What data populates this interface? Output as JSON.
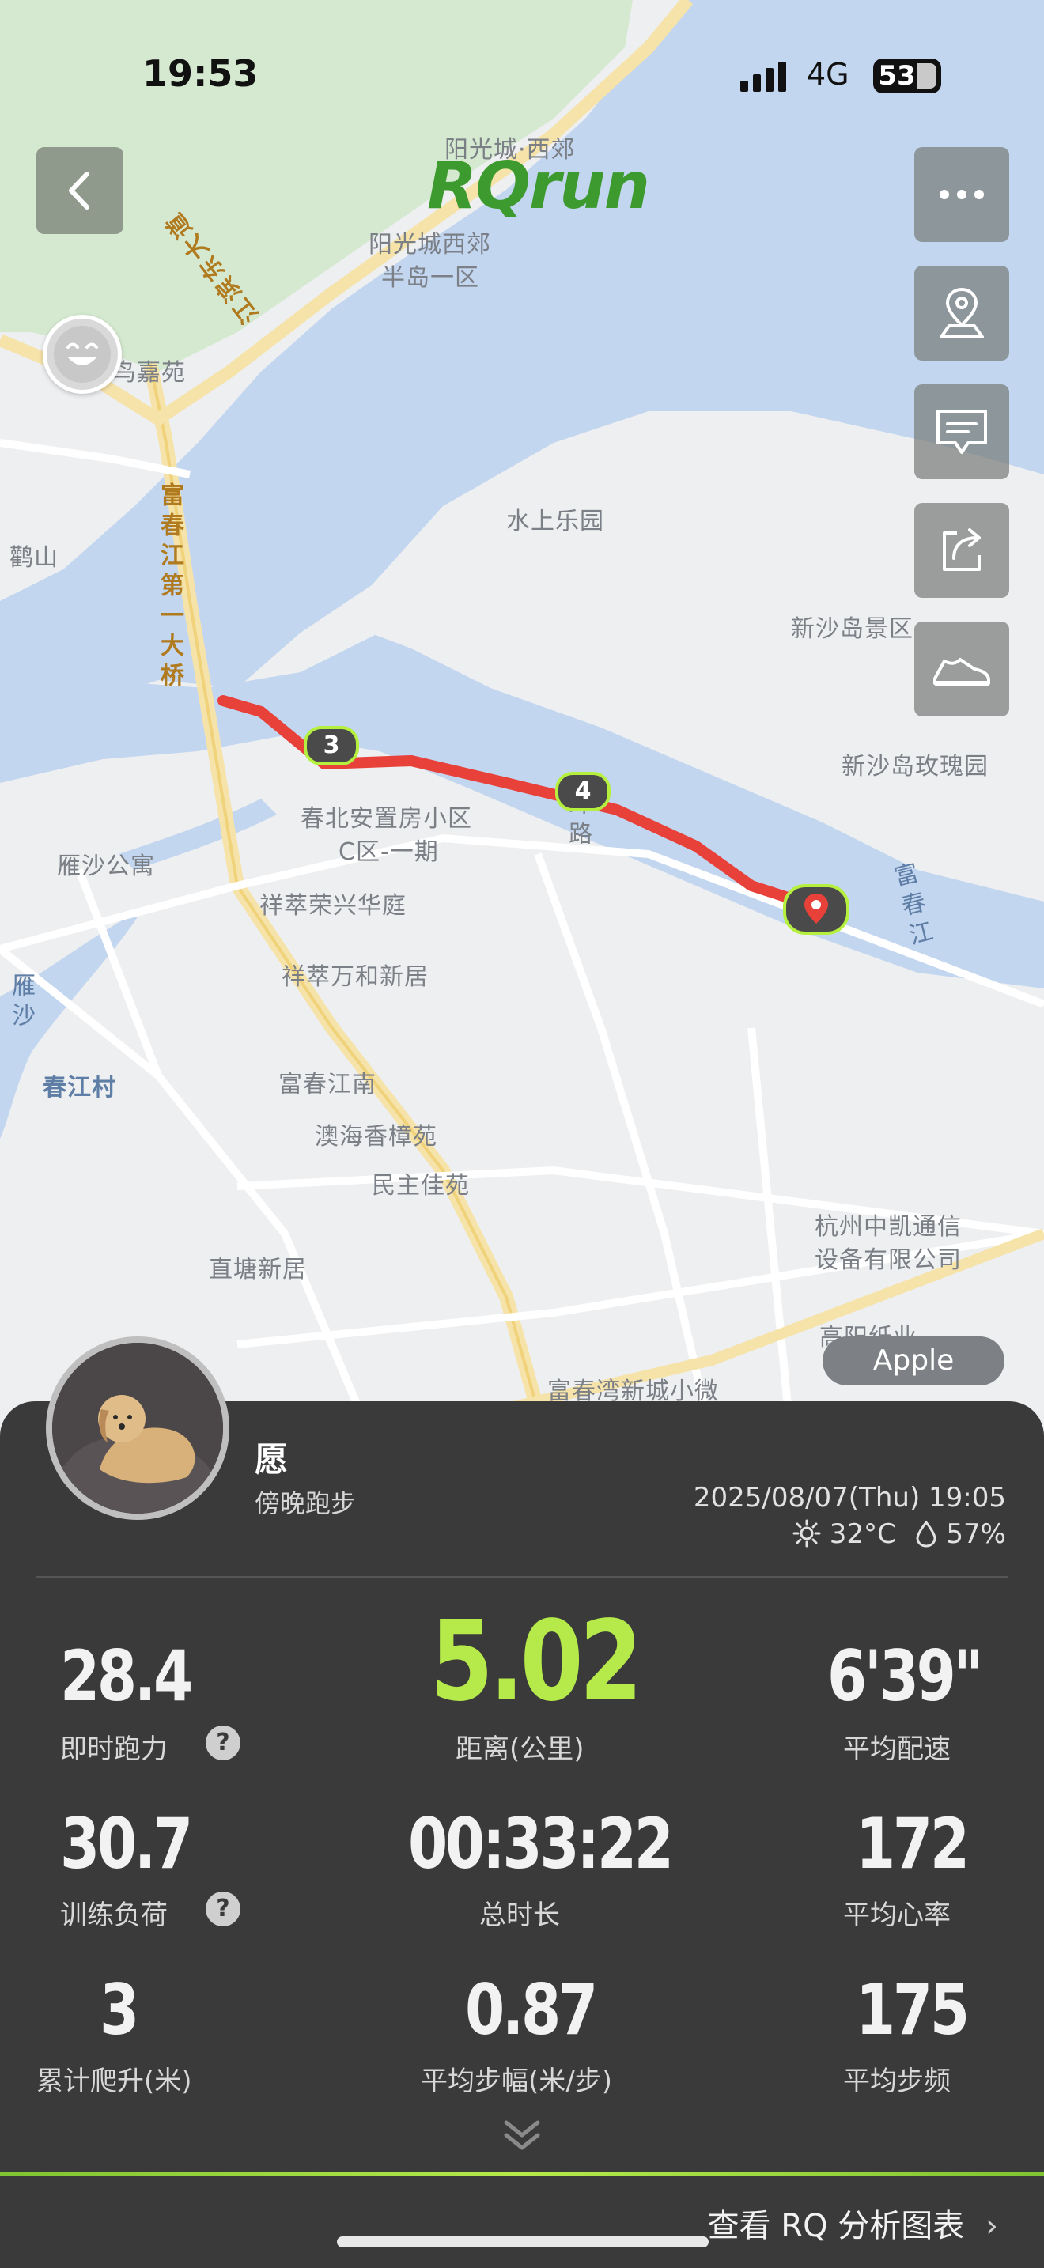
{
  "status_bar": {
    "time": "19:53",
    "network": "4G",
    "battery": "53"
  },
  "map": {
    "logo": "RQrun",
    "place_labels": [
      {
        "id": "yangguang-xijiao",
        "text": "阳光城·西郊"
      },
      {
        "id": "yangguang-xijiao-2",
        "text": "阳光城西郊"
      },
      {
        "id": "bandao-yiqu",
        "text": "半岛一区"
      },
      {
        "id": "niao-jia-yuan",
        "text": "鸟嘉苑"
      },
      {
        "id": "he-shan",
        "text": "鹳山"
      },
      {
        "id": "shuishang-leyuan",
        "text": "水上乐园"
      },
      {
        "id": "xinshadao-jingqu",
        "text": "新沙岛景区"
      },
      {
        "id": "xinshadao-meiguiyuan",
        "text": "新沙岛玫瑰园"
      },
      {
        "id": "chunbei-anzhi",
        "text": "春北安置房小区"
      },
      {
        "id": "c-qu",
        "text": "C区-一期"
      },
      {
        "id": "yansha-gongyu",
        "text": "雁沙公寓"
      },
      {
        "id": "xiangcui-rongxing",
        "text": "祥萃荣兴华庭"
      },
      {
        "id": "xiangcui-wanhe",
        "text": "祥萃万和新居"
      },
      {
        "id": "chunjiang-cun",
        "text": "春江村"
      },
      {
        "id": "fuchun-jiangnan",
        "text": "富春江南"
      },
      {
        "id": "aohai-xiangzhang",
        "text": "澳海香樟苑"
      },
      {
        "id": "minzhu-jiayuan",
        "text": "民主佳苑"
      },
      {
        "id": "zhitang-xinju",
        "text": "直塘新居"
      },
      {
        "id": "hangzhou-zhongkai",
        "text": "杭州中凯通信"
      },
      {
        "id": "shebei-youxian",
        "text": "设备有限公司"
      },
      {
        "id": "gaoyang-zhiye",
        "text": "高阳纸业"
      },
      {
        "id": "fuchunwan",
        "text": "富春湾新城小微"
      }
    ],
    "road_labels": [
      {
        "id": "jiangbin-dongdadao",
        "text": "江滨东大道"
      },
      {
        "id": "fuchunjiang-diyi-daqiao",
        "text": "富春江第一大桥"
      },
      {
        "id": "wei-lu",
        "text": "纬路"
      },
      {
        "id": "fuchun-jiang",
        "text": "富春江"
      },
      {
        "id": "yan-sha",
        "text": "雁沙"
      }
    ],
    "km_markers": [
      "3",
      "4"
    ],
    "source_tag": "Apple"
  },
  "run": {
    "user_name": "愿",
    "run_title": "傍晚跑步",
    "datetime": "2025/08/07(Thu) 19:05",
    "temperature": "32°C",
    "humidity": "57%"
  },
  "stats": [
    {
      "id": "running-power",
      "value": "28.4",
      "label": "即时跑力",
      "help": true
    },
    {
      "id": "distance",
      "value": "5.02",
      "label": "距离(公里)",
      "highlight": true
    },
    {
      "id": "avg-pace",
      "value": "6'39\"",
      "label": "平均配速"
    },
    {
      "id": "training-load",
      "value": "30.7",
      "label": "训练负荷",
      "help": true
    },
    {
      "id": "duration",
      "value": "00:33:22",
      "label": "总时长"
    },
    {
      "id": "avg-hr",
      "value": "172",
      "label": "平均心率"
    },
    {
      "id": "elevation",
      "value": "3",
      "label": "累计爬升(米)"
    },
    {
      "id": "stride",
      "value": "0.87",
      "label": "平均步幅(米/步)"
    },
    {
      "id": "cadence",
      "value": "175",
      "label": "平均步频"
    }
  ],
  "help_glyph": "?",
  "footer": {
    "analysis_link": "查看 RQ 分析图表",
    "chevron": "›"
  },
  "colors": {
    "accent": "#b6ea4a",
    "route": "#e8413a",
    "card": "#3a3a3a",
    "water": "#c3d6f0",
    "park": "#d4e9cf"
  }
}
